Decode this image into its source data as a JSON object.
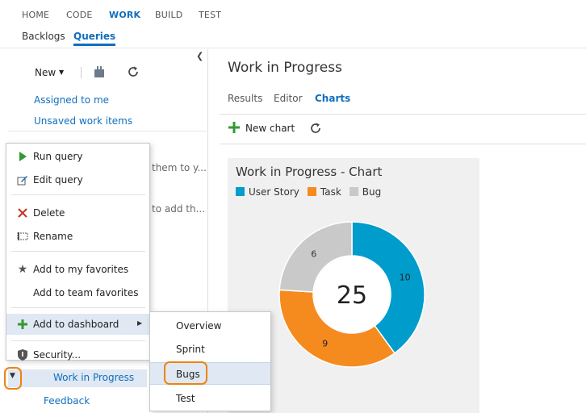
{
  "top_nav": [
    "HOME",
    "CODE",
    "WORK",
    "BUILD",
    "TEST"
  ],
  "sub_nav": [
    "Backlogs",
    "Queries"
  ],
  "left": {
    "new_label": "New",
    "links": [
      "Assigned to me",
      "Unsaved work items"
    ],
    "faint_texts": [
      "them to y...",
      "to add th..."
    ],
    "current_query": "Work in Progress",
    "feedback": "Feedback"
  },
  "context_menu": {
    "items": {
      "run_query": "Run query",
      "edit_query": "Edit query",
      "delete": "Delete",
      "rename": "Rename",
      "add_my_favorites": "Add to my favorites",
      "add_team_favorites": "Add to team favorites",
      "add_dashboard": "Add to dashboard",
      "security": "Security..."
    }
  },
  "submenu": [
    "Overview",
    "Sprint",
    "Bugs",
    "Test"
  ],
  "main": {
    "title": "Work in Progress",
    "tabs": [
      "Results",
      "Editor",
      "Charts"
    ],
    "new_chart": "New chart"
  },
  "chart_data": {
    "type": "pie",
    "title": "Work in Progress - Chart",
    "total": 25,
    "slices": [
      {
        "label": "User Story",
        "value": 10,
        "color": "#009ccc"
      },
      {
        "label": "Task",
        "value": 9,
        "color": "#f58b1f"
      },
      {
        "label": "Bug",
        "value": 6,
        "color": "#c9c9c9"
      }
    ],
    "legend_placement": "top-left"
  },
  "colors": {
    "accent": "#106ebe",
    "highlight": "#f0820f"
  }
}
